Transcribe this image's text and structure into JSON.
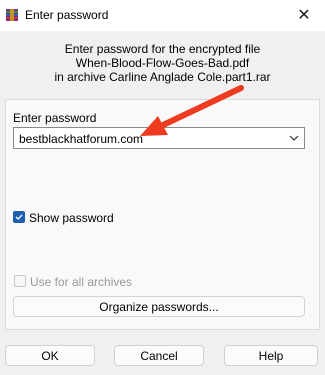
{
  "window": {
    "title": "Enter password",
    "close_glyph": "✕"
  },
  "header": {
    "line1": "Enter password for the encrypted file",
    "line2": "When-Blood-Flow-Goes-Bad.pdf",
    "line3": "in archive Carline Anglade Cole.part1.rar"
  },
  "password": {
    "label": "Enter password",
    "value": "bestblackhatforum.com"
  },
  "options": {
    "show_password": {
      "label": "Show password",
      "checked": true
    },
    "use_for_all": {
      "label": "Use for all archives",
      "checked": false,
      "disabled": true
    }
  },
  "buttons": {
    "organize": "Organize passwords...",
    "ok": "OK",
    "cancel": "Cancel",
    "help": "Help"
  },
  "colors": {
    "annotation_arrow": "#ee3b1f",
    "checkbox_accent": "#1f5fb3"
  },
  "icons": [
    "winrar-app-icon",
    "close-icon",
    "chevron-down-icon",
    "checkmark-icon",
    "annotation-arrow"
  ]
}
